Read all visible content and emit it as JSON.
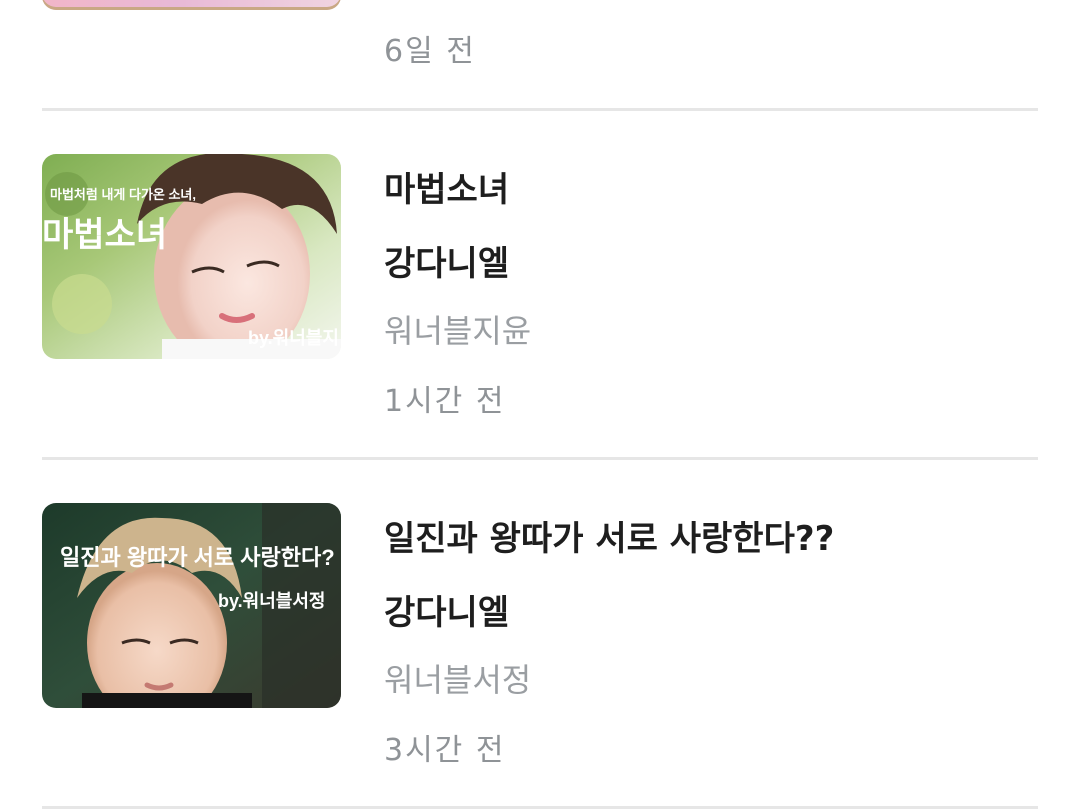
{
  "list": {
    "previous_item": {
      "time": "6일 전"
    },
    "items": [
      {
        "title": "마법소녀",
        "artist": "강다니엘",
        "author": "워너블지윤",
        "time": "1시간 전",
        "thumbnail": {
          "caption_small": "마법처럼 내게 다가온 소녀,",
          "caption_big": "마법소녀",
          "byline": "by.워너블지"
        }
      },
      {
        "title": "일진과 왕따가 서로 사랑한다??",
        "artist": "강다니엘",
        "author": "워너블서정",
        "time": "3시간 전",
        "thumbnail": {
          "caption_big": "일진과 왕따가 서로 사랑한다?",
          "byline": "by.워너블서정"
        }
      }
    ]
  },
  "colors": {
    "title_text": "#1e1e1e",
    "secondary_text": "#9a9ea2",
    "divider": "#e6e6e6"
  }
}
